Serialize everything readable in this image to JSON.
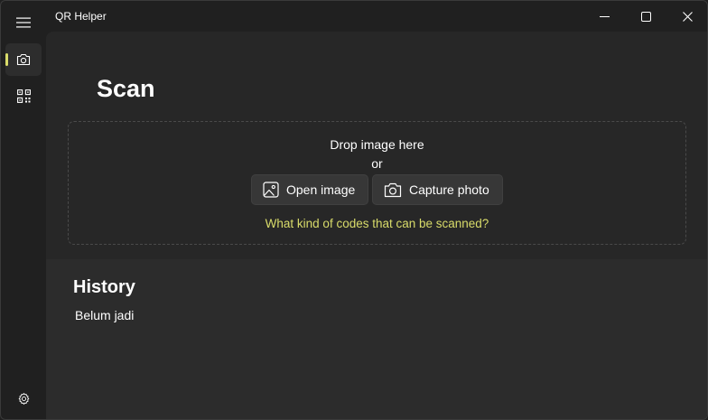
{
  "window": {
    "title": "QR Helper"
  },
  "nav": {
    "items": [
      {
        "icon": "camera-icon",
        "active": true
      },
      {
        "icon": "qr-code-icon",
        "active": false
      }
    ],
    "footer_icon": "gear-icon",
    "accent": "#d9dc6a"
  },
  "scan": {
    "title": "Scan",
    "drop_text": "Drop image here",
    "or_text": "or",
    "open_button": "Open image",
    "capture_button": "Capture photo",
    "codes_link": "What kind of codes that can be scanned?"
  },
  "history": {
    "title": "History",
    "empty_text": "Belum jadi"
  }
}
